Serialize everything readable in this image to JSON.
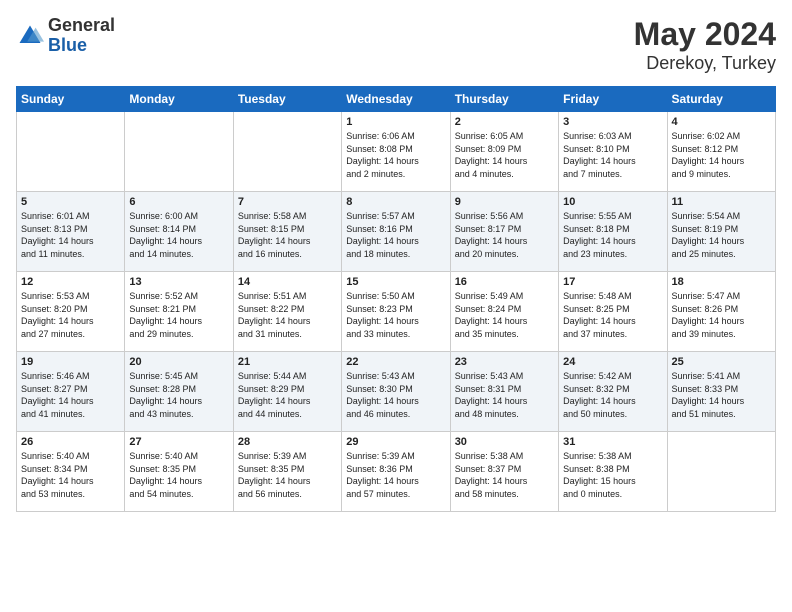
{
  "header": {
    "logo_general": "General",
    "logo_blue": "Blue",
    "month": "May 2024",
    "location": "Derekoy, Turkey"
  },
  "weekdays": [
    "Sunday",
    "Monday",
    "Tuesday",
    "Wednesday",
    "Thursday",
    "Friday",
    "Saturday"
  ],
  "weeks": [
    [
      {
        "day": "",
        "content": ""
      },
      {
        "day": "",
        "content": ""
      },
      {
        "day": "",
        "content": ""
      },
      {
        "day": "1",
        "content": "Sunrise: 6:06 AM\nSunset: 8:08 PM\nDaylight: 14 hours\nand 2 minutes."
      },
      {
        "day": "2",
        "content": "Sunrise: 6:05 AM\nSunset: 8:09 PM\nDaylight: 14 hours\nand 4 minutes."
      },
      {
        "day": "3",
        "content": "Sunrise: 6:03 AM\nSunset: 8:10 PM\nDaylight: 14 hours\nand 7 minutes."
      },
      {
        "day": "4",
        "content": "Sunrise: 6:02 AM\nSunset: 8:12 PM\nDaylight: 14 hours\nand 9 minutes."
      }
    ],
    [
      {
        "day": "5",
        "content": "Sunrise: 6:01 AM\nSunset: 8:13 PM\nDaylight: 14 hours\nand 11 minutes."
      },
      {
        "day": "6",
        "content": "Sunrise: 6:00 AM\nSunset: 8:14 PM\nDaylight: 14 hours\nand 14 minutes."
      },
      {
        "day": "7",
        "content": "Sunrise: 5:58 AM\nSunset: 8:15 PM\nDaylight: 14 hours\nand 16 minutes."
      },
      {
        "day": "8",
        "content": "Sunrise: 5:57 AM\nSunset: 8:16 PM\nDaylight: 14 hours\nand 18 minutes."
      },
      {
        "day": "9",
        "content": "Sunrise: 5:56 AM\nSunset: 8:17 PM\nDaylight: 14 hours\nand 20 minutes."
      },
      {
        "day": "10",
        "content": "Sunrise: 5:55 AM\nSunset: 8:18 PM\nDaylight: 14 hours\nand 23 minutes."
      },
      {
        "day": "11",
        "content": "Sunrise: 5:54 AM\nSunset: 8:19 PM\nDaylight: 14 hours\nand 25 minutes."
      }
    ],
    [
      {
        "day": "12",
        "content": "Sunrise: 5:53 AM\nSunset: 8:20 PM\nDaylight: 14 hours\nand 27 minutes."
      },
      {
        "day": "13",
        "content": "Sunrise: 5:52 AM\nSunset: 8:21 PM\nDaylight: 14 hours\nand 29 minutes."
      },
      {
        "day": "14",
        "content": "Sunrise: 5:51 AM\nSunset: 8:22 PM\nDaylight: 14 hours\nand 31 minutes."
      },
      {
        "day": "15",
        "content": "Sunrise: 5:50 AM\nSunset: 8:23 PM\nDaylight: 14 hours\nand 33 minutes."
      },
      {
        "day": "16",
        "content": "Sunrise: 5:49 AM\nSunset: 8:24 PM\nDaylight: 14 hours\nand 35 minutes."
      },
      {
        "day": "17",
        "content": "Sunrise: 5:48 AM\nSunset: 8:25 PM\nDaylight: 14 hours\nand 37 minutes."
      },
      {
        "day": "18",
        "content": "Sunrise: 5:47 AM\nSunset: 8:26 PM\nDaylight: 14 hours\nand 39 minutes."
      }
    ],
    [
      {
        "day": "19",
        "content": "Sunrise: 5:46 AM\nSunset: 8:27 PM\nDaylight: 14 hours\nand 41 minutes."
      },
      {
        "day": "20",
        "content": "Sunrise: 5:45 AM\nSunset: 8:28 PM\nDaylight: 14 hours\nand 43 minutes."
      },
      {
        "day": "21",
        "content": "Sunrise: 5:44 AM\nSunset: 8:29 PM\nDaylight: 14 hours\nand 44 minutes."
      },
      {
        "day": "22",
        "content": "Sunrise: 5:43 AM\nSunset: 8:30 PM\nDaylight: 14 hours\nand 46 minutes."
      },
      {
        "day": "23",
        "content": "Sunrise: 5:43 AM\nSunset: 8:31 PM\nDaylight: 14 hours\nand 48 minutes."
      },
      {
        "day": "24",
        "content": "Sunrise: 5:42 AM\nSunset: 8:32 PM\nDaylight: 14 hours\nand 50 minutes."
      },
      {
        "day": "25",
        "content": "Sunrise: 5:41 AM\nSunset: 8:33 PM\nDaylight: 14 hours\nand 51 minutes."
      }
    ],
    [
      {
        "day": "26",
        "content": "Sunrise: 5:40 AM\nSunset: 8:34 PM\nDaylight: 14 hours\nand 53 minutes."
      },
      {
        "day": "27",
        "content": "Sunrise: 5:40 AM\nSunset: 8:35 PM\nDaylight: 14 hours\nand 54 minutes."
      },
      {
        "day": "28",
        "content": "Sunrise: 5:39 AM\nSunset: 8:35 PM\nDaylight: 14 hours\nand 56 minutes."
      },
      {
        "day": "29",
        "content": "Sunrise: 5:39 AM\nSunset: 8:36 PM\nDaylight: 14 hours\nand 57 minutes."
      },
      {
        "day": "30",
        "content": "Sunrise: 5:38 AM\nSunset: 8:37 PM\nDaylight: 14 hours\nand 58 minutes."
      },
      {
        "day": "31",
        "content": "Sunrise: 5:38 AM\nSunset: 8:38 PM\nDaylight: 15 hours\nand 0 minutes."
      },
      {
        "day": "",
        "content": ""
      }
    ]
  ]
}
